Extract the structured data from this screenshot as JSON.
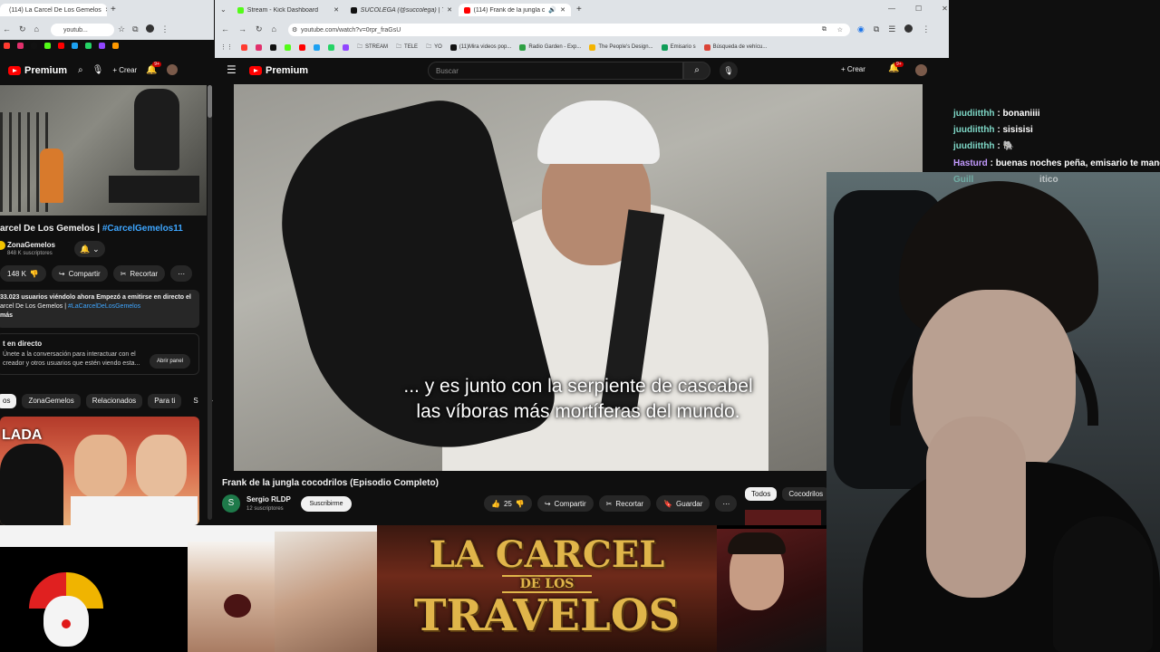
{
  "left_browser": {
    "tab_title": "(114) La Carcel De Los Gemelos",
    "url": "youtub...",
    "premium_label": "Premium",
    "create_label": "Crear",
    "notif_badge": "9+",
    "video_title_prefix": "arcel De Los Gemelos | ",
    "video_hashtag": "#CarcelGemelos11",
    "channel_name": "ZonaGemelos",
    "channel_subs": "848 K suscriptores",
    "likes": "148 K",
    "share_label": "Compartir",
    "clip_label": "Recortar",
    "live_stats": "33.023 usuarios viéndolo ahora  Empezó a emitirse en directo el",
    "desc_line2": "arcel De Los Gemelos | ",
    "desc_hashtag": "#LaCarcelDeLosGemelos",
    "desc_more": "más",
    "live_chat_title": "t en directo",
    "live_chat_text": "Únete a la conversación para interactuar con el creador y otros usuarios que estén viendo esta...",
    "open_panel_label": "Abrir panel",
    "chips": [
      "os",
      "ZonaGemelos",
      "Relacionados",
      "Para ti",
      "S"
    ]
  },
  "right_browser": {
    "tabs": [
      {
        "title": "Stream - Kick Dashboard",
        "color": "#53fc18"
      },
      {
        "title": "SUCOLEGA (@succolega) | Ti...",
        "color": "#111111"
      },
      {
        "title": "(114) Frank de la jungla co...",
        "color": "#ff0000"
      }
    ],
    "url": "youtube.com/watch?v=0rpr_fraGsU",
    "bookmarks": [
      "STREAM",
      "TELE",
      "YO",
      "(11)Mira videos pop...",
      "Radio Garden - Exp...",
      "The People's Design...",
      "Emisario s",
      "Búsqueda de vehícu..."
    ],
    "premium_label": "Premium",
    "search_placeholder": "Buscar",
    "create_label": "Crear",
    "notif_badge": "9+",
    "subtitle_line1": "... y es junto con la serpiente de cascabel",
    "subtitle_line2": "las víboras más mortíferas del mundo.",
    "video_title": "Frank de la jungla cocodrilos (Episodio Completo)",
    "channel_initial": "S",
    "channel_name": "Sergio RLDP",
    "channel_subs": "12 suscriptores",
    "subscribe_label": "Suscribirme",
    "likes": "25",
    "share_label": "Compartir",
    "clip_label": "Recortar",
    "save_label": "Guardar",
    "chips": [
      "Todos",
      "Cocodrilos"
    ]
  },
  "chat": [
    {
      "user": "juudiitthh",
      "msg": "bonaniiii",
      "color": "#7fd9c8"
    },
    {
      "user": "juudiitthh",
      "msg": "sisisisi",
      "color": "#7fd9c8"
    },
    {
      "user": "juudiitthh",
      "msg": "🐘",
      "color": "#7fd9c8"
    },
    {
      "user": "Hasturd",
      "msg": "buenas noches peña, emisario te mand",
      "color": "#c49bff"
    },
    {
      "user": "Guill",
      "msg": "itico",
      "color": "#7fd9c8"
    }
  ],
  "banner": {
    "line1": "LA CARCEL",
    "line2": "DE LOS",
    "line3": "TRAVELOS"
  },
  "thumb_caption": "LADA"
}
